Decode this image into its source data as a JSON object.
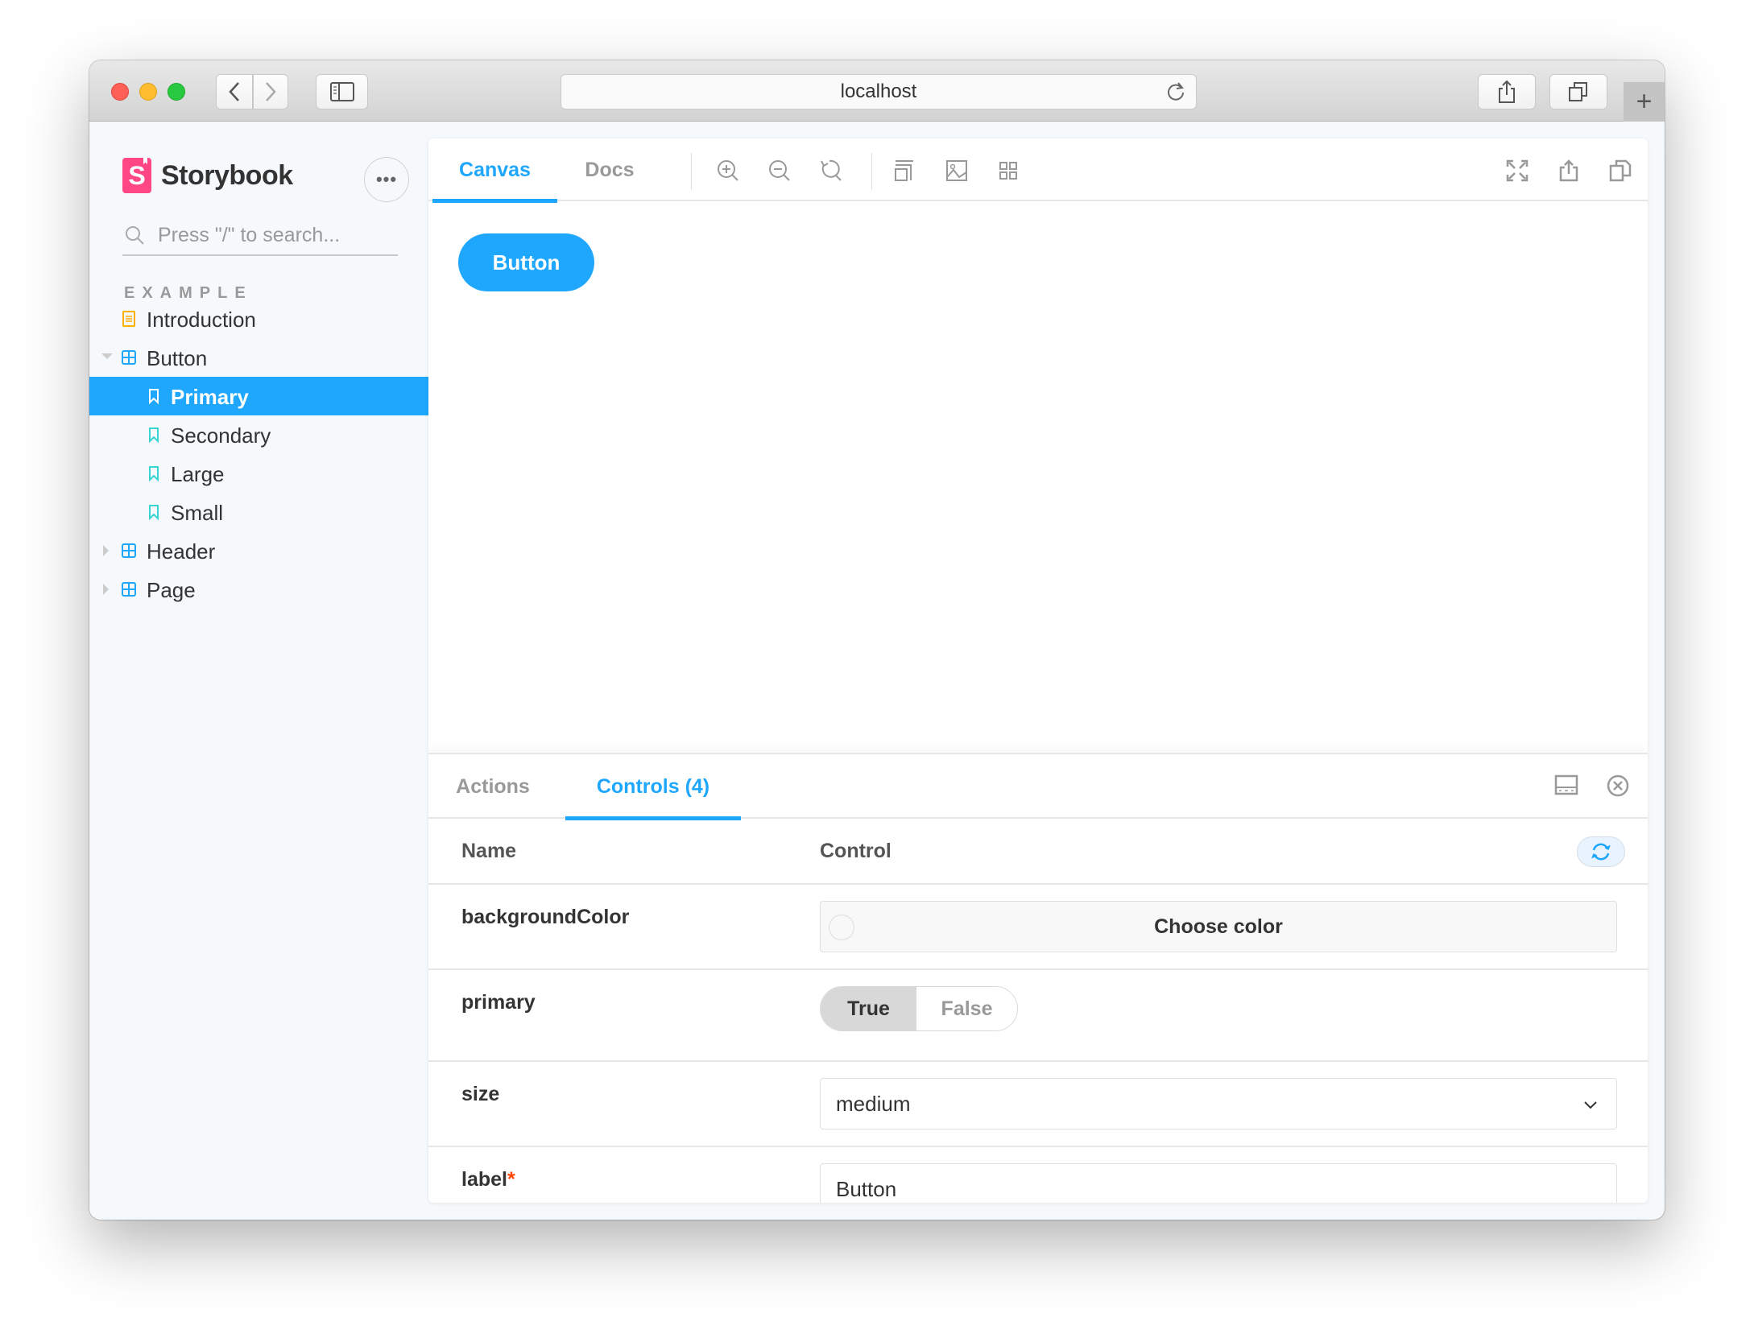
{
  "browser": {
    "url": "localhost"
  },
  "sidebar": {
    "brand": "Storybook",
    "brand_mark": "S",
    "menu_label": "•••",
    "search_placeholder": "Press \"/\" to search...",
    "section_title": "EXAMPLE",
    "items": [
      {
        "label": "Introduction",
        "type": "document",
        "icon": "document-icon",
        "color": "#ffae00"
      },
      {
        "label": "Button",
        "type": "component",
        "icon": "component-icon",
        "expanded": true,
        "color": "#1ea7fd"
      },
      {
        "label": "Primary",
        "type": "story",
        "icon": "bookmark-icon",
        "selected": true,
        "color": "#ffffff"
      },
      {
        "label": "Secondary",
        "type": "story",
        "icon": "bookmark-icon",
        "color": "#37d5d3"
      },
      {
        "label": "Large",
        "type": "story",
        "icon": "bookmark-icon",
        "color": "#37d5d3"
      },
      {
        "label": "Small",
        "type": "story",
        "icon": "bookmark-icon",
        "color": "#37d5d3"
      },
      {
        "label": "Header",
        "type": "component",
        "icon": "component-icon",
        "expanded": false,
        "color": "#1ea7fd"
      },
      {
        "label": "Page",
        "type": "component",
        "icon": "component-icon",
        "expanded": false,
        "color": "#1ea7fd"
      }
    ]
  },
  "toolbar": {
    "tabs": [
      {
        "label": "Canvas",
        "active": true
      },
      {
        "label": "Docs",
        "active": false
      }
    ],
    "tools": [
      "zoom-in-icon",
      "zoom-out-icon",
      "zoom-reset-icon",
      "background-icon",
      "grid-icon",
      "outline-icon"
    ],
    "right_tools": [
      "fullscreen-icon",
      "share-icon",
      "copy-link-icon"
    ]
  },
  "preview": {
    "button_label": "Button"
  },
  "addons": {
    "tabs": [
      {
        "label": "Actions",
        "active": false
      },
      {
        "label": "Controls (4)",
        "active": true
      }
    ],
    "header": {
      "name": "Name",
      "control": "Control"
    },
    "rows": [
      {
        "name": "backgroundColor",
        "control": "color",
        "value": "Choose color",
        "required": false
      },
      {
        "name": "primary",
        "control": "boolean",
        "options": [
          "True",
          "False"
        ],
        "value": "True",
        "required": false
      },
      {
        "name": "size",
        "control": "select",
        "value": "medium",
        "required": false
      },
      {
        "name": "label",
        "control": "text",
        "value": "Button",
        "required": true,
        "required_mark": "*"
      }
    ]
  },
  "colors": {
    "accent": "#1ea7fd",
    "brand": "#ff4785",
    "story": "#37d5d3",
    "document": "#ffae00",
    "required": "#ff4400"
  }
}
